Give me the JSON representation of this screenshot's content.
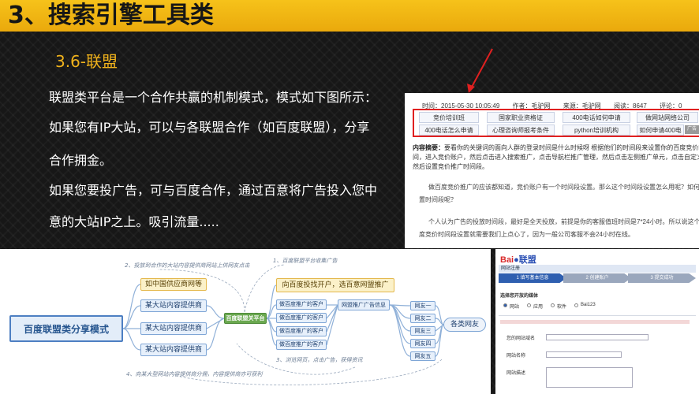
{
  "slide": {
    "title": "3、搜索引擎工具类",
    "subtitle": "3.6-联盟",
    "lines": [
      "联盟类平台是一个合作共赢的机制模式，模式如下图所示：",
      "如果您有IP大站，可以与各联盟合作（如百度联盟），分享",
      "合作拥金。",
      "如果您要投广告，可与百度合作，通过百意将广告投入您中",
      "意的大站IP之上。吸引流量....."
    ]
  },
  "article": {
    "meta": [
      "时间：2015-05-30 10:05:49",
      "作者：毛驴网",
      "来源：毛驴网",
      "阅读：8647",
      "评论：0"
    ],
    "keywords": [
      [
        "竞价培训班",
        "国家职业资格证",
        "400电话如何申请",
        "做网站网络公司"
      ],
      [
        "400电话怎么申请",
        "心理咨询师报考条件",
        "python培训机构",
        "如何申请400电"
      ]
    ],
    "ad_badge": "广告",
    "summary_label": "内容摘要：",
    "summary_lines": [
      "要看你的关键词的面向人群的登录时间是什么时候呀 根据他们的时间段来设置你的百度竞价时",
      "间，进入竞价账户，然后点击进入搜索推广，点击导航栏推广管理，然后点击左侧推广单元，点击自定义",
      "然后设置竞价推广时间段。"
    ],
    "paragraphs": [
      "做百度竞价推广的应该都知道，竞价账户有一个时间段设置。那么这个时间段设置怎么用呢？如何设",
      "置时间段呢？",
      "个人认为广告的投放时间段，最好是全天投放，前提是你的客服值班时间是7*24小时。所以说这个百",
      "度竞价时间段设置就需要我们上点心了，因为一般公司客服不会24小时在线。"
    ]
  },
  "mindmap": {
    "root": "百度联盟类分享模式",
    "left_top": "如中国供应商网等",
    "left_items": [
      "某大站内容提供商",
      "某大站内容提供商",
      "某大站内容提供商"
    ],
    "center": "百度联盟关平台",
    "right_top": "向百度投找开户，选百意网盟推广",
    "clients": [
      "做百度推广的客户",
      "做百度推广的客户",
      "做百度推广的客户",
      "做百度推广的客户"
    ],
    "ad_info": "网盟推广广告信息",
    "users": [
      "网友一",
      "网友二",
      "网友三",
      "网友四",
      "网友五"
    ],
    "all_users": "各类网友",
    "notes": [
      "2、投放到合作的大站内容提供商网站上供网友点击",
      "1、百度联盟平台收集广告",
      "3、浏览网页，点击广告，获得资讯",
      "4、向某大型网站内容提供商分佣，内容提供商亦可获利"
    ]
  },
  "baidu": {
    "logo": "Bai",
    "logo_union": "联盟",
    "section": "网站注册",
    "steps": [
      "1 填写基本信息",
      "2 创建账户",
      "3 提交成功"
    ],
    "media_label": "选择您开放的媒体",
    "media_options": [
      "网站",
      "应用",
      "软件",
      "Bai123"
    ],
    "fields": [
      "您的网站域名",
      "网站名称",
      "网站描述"
    ]
  }
}
